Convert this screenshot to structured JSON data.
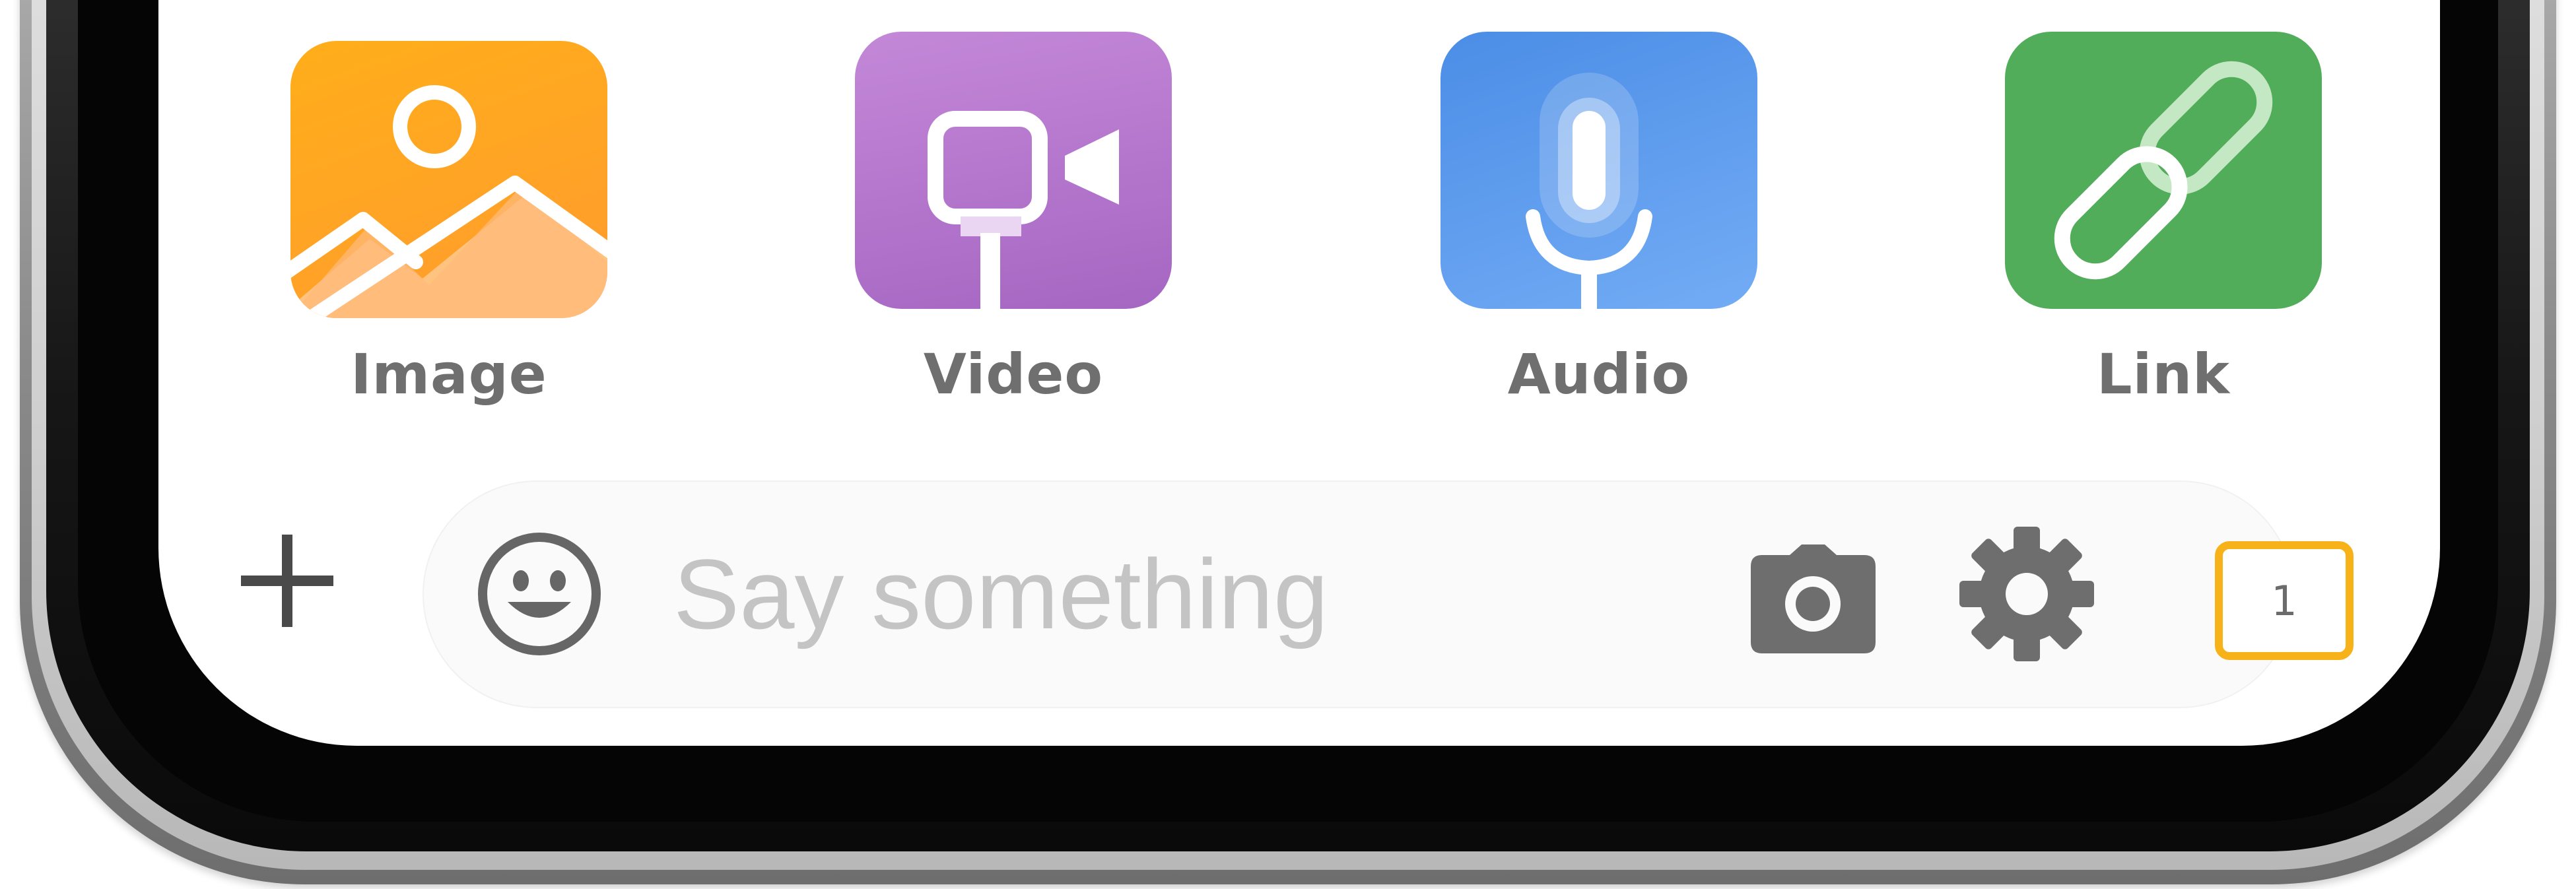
{
  "attachments": {
    "items": [
      {
        "id": "image",
        "label": "Image",
        "icon": "image-icon",
        "color": "#ffa41c"
      },
      {
        "id": "video",
        "label": "Video",
        "icon": "video-camera-icon",
        "color": "#b377cd"
      },
      {
        "id": "audio",
        "label": "Audio",
        "icon": "microphone-icon",
        "color": "#5a9bec"
      },
      {
        "id": "link",
        "label": "Link",
        "icon": "link-icon",
        "color": "#52ad5a"
      }
    ]
  },
  "composer": {
    "plus_icon": "plus-icon",
    "emoji_icon": "smiley-face-icon",
    "placeholder": "Say something",
    "value": "",
    "camera_icon": "camera-icon",
    "settings_icon": "gear-icon",
    "badge_count": "1",
    "badge_color": "#f7b21a"
  }
}
